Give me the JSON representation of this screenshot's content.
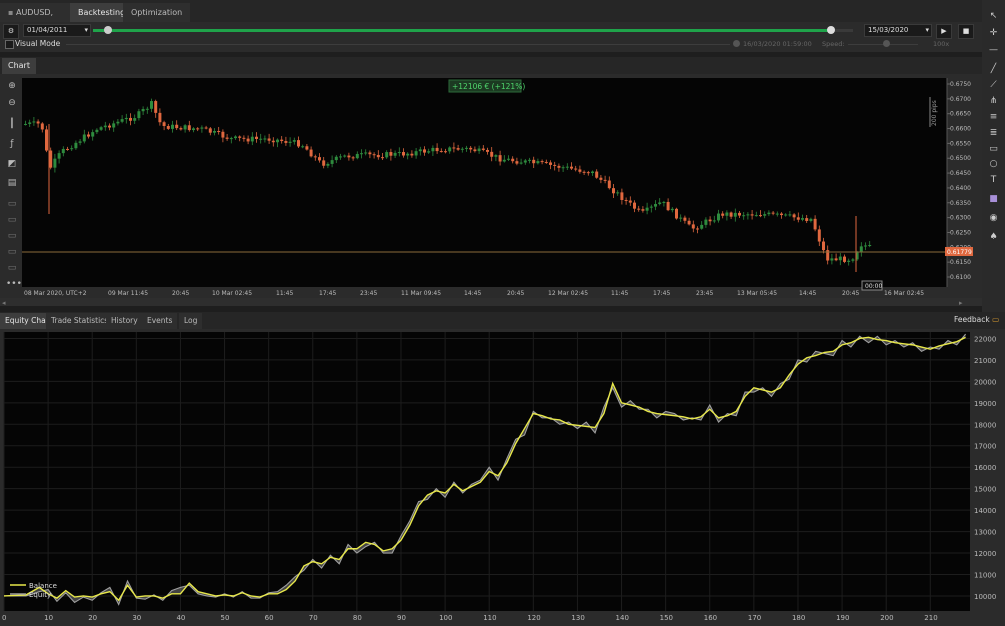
{
  "tabs": [
    {
      "label": "AUDUSD, m45",
      "icon": "chart-icon"
    },
    {
      "label": "Backtesting"
    },
    {
      "label": "Optimization"
    }
  ],
  "params": {
    "start_date": "01/04/2011",
    "end_date": "15/03/2020",
    "visual_mode_label": "Visual Mode",
    "current_time": "16/03/2020 01:59:00",
    "speed_label": "Speed:",
    "speed_value": "100x",
    "progress": 0.99
  },
  "chart": {
    "tab_label": "Chart",
    "profit_badge": "+12106 € (+121%)",
    "scale_label": "200 pips",
    "current_price": "0.61779",
    "price_ticks": [
      "0.6750",
      "0.6700",
      "0.6650",
      "0.6600",
      "0.6550",
      "0.6500",
      "0.6450",
      "0.6400",
      "0.6350",
      "0.6300",
      "0.6250",
      "0.6200",
      "0.6150",
      "0.6100"
    ],
    "time_ticks": [
      "08 Mar 2020, UTC+2",
      "09 Mar 11:45",
      "20:45",
      "10 Mar 02:45",
      "11:45",
      "17:45",
      "23:45",
      "11 Mar 09:45",
      "14:45",
      "20:45",
      "12 Mar 02:45",
      "11:45",
      "17:45",
      "23:45",
      "13 Mar 05:45",
      "14:45",
      "20:45",
      "16 Mar 02:45"
    ],
    "cursor_time": "00:00",
    "colors": {
      "bull": "#2e8b3e",
      "bear": "#e0683f",
      "price_line": "#8a6a3a"
    }
  },
  "bottom_tabs": [
    "Equity Chart",
    "Trade Statistics",
    "History",
    "Events",
    "Log"
  ],
  "feedback_label": "Feedback",
  "chart_data": {
    "type": "line",
    "xlabel": "",
    "ylabel": "",
    "x_ticks": [
      0,
      10,
      20,
      30,
      40,
      50,
      60,
      70,
      80,
      90,
      100,
      110,
      120,
      130,
      140,
      150,
      160,
      170,
      180,
      190,
      200,
      210
    ],
    "y_ticks": [
      10000,
      11000,
      12000,
      13000,
      14000,
      15000,
      16000,
      17000,
      18000,
      19000,
      20000,
      21000,
      22000
    ],
    "xlim": [
      0,
      219
    ],
    "ylim": [
      9300,
      22300
    ],
    "legend_position": "bottom-left",
    "series": [
      {
        "name": "Balance",
        "color": "#e8e84a",
        "x": [
          0,
          5,
          8,
          10,
          12,
          14,
          16,
          18,
          20,
          22,
          24,
          26,
          28,
          30,
          32,
          34,
          36,
          38,
          40,
          42,
          44,
          46,
          48,
          50,
          52,
          54,
          56,
          58,
          60,
          62,
          64,
          66,
          68,
          70,
          72,
          74,
          76,
          78,
          80,
          82,
          84,
          86,
          88,
          90,
          92,
          94,
          96,
          98,
          100,
          102,
          104,
          106,
          108,
          110,
          112,
          114,
          116,
          118,
          120,
          122,
          124,
          126,
          128,
          130,
          132,
          134,
          136,
          138,
          140,
          142,
          144,
          146,
          148,
          150,
          152,
          154,
          156,
          158,
          160,
          162,
          164,
          166,
          168,
          170,
          172,
          174,
          176,
          178,
          180,
          182,
          184,
          186,
          188,
          190,
          192,
          194,
          196,
          198,
          200,
          202,
          204,
          206,
          208,
          210,
          212,
          214,
          216,
          218
        ],
        "y": [
          10000,
          10050,
          10400,
          10100,
          9900,
          10250,
          9950,
          10000,
          9950,
          10100,
          10200,
          9800,
          10500,
          9950,
          10000,
          10000,
          9900,
          10100,
          10100,
          10600,
          10200,
          10100,
          10000,
          10050,
          10000,
          10150,
          10000,
          9950,
          10100,
          10100,
          10300,
          10700,
          11400,
          11600,
          11500,
          11800,
          11700,
          12200,
          12200,
          12500,
          12400,
          12100,
          12200,
          12600,
          13300,
          14200,
          14700,
          14900,
          14800,
          15200,
          14900,
          15100,
          15300,
          15800,
          15600,
          16200,
          17100,
          17800,
          18500,
          18400,
          18250,
          18200,
          18000,
          17950,
          17900,
          17850,
          18500,
          19900,
          19000,
          18900,
          18800,
          18600,
          18500,
          18450,
          18400,
          18350,
          18250,
          18350,
          18700,
          18300,
          18400,
          18600,
          19300,
          19700,
          19600,
          19500,
          19700,
          20300,
          20800,
          21100,
          21200,
          21350,
          21400,
          21700,
          21800,
          22000,
          22050,
          21950,
          21900,
          21800,
          21750,
          21700,
          21600,
          21500,
          21650,
          21750,
          21850,
          22050
        ]
      },
      {
        "name": "Equity",
        "color": "#a0a0a0",
        "x": [
          0,
          5,
          8,
          10,
          12,
          14,
          16,
          18,
          20,
          22,
          24,
          26,
          28,
          30,
          32,
          34,
          36,
          38,
          40,
          42,
          44,
          46,
          48,
          50,
          52,
          54,
          56,
          58,
          60,
          62,
          64,
          66,
          68,
          70,
          72,
          74,
          76,
          78,
          80,
          82,
          84,
          86,
          88,
          90,
          92,
          94,
          96,
          98,
          100,
          102,
          104,
          106,
          108,
          110,
          112,
          114,
          116,
          118,
          120,
          122,
          124,
          126,
          128,
          130,
          132,
          134,
          136,
          138,
          140,
          142,
          144,
          146,
          148,
          150,
          152,
          154,
          156,
          158,
          160,
          162,
          164,
          166,
          168,
          170,
          172,
          174,
          176,
          178,
          180,
          182,
          184,
          186,
          188,
          190,
          192,
          194,
          196,
          198,
          200,
          202,
          204,
          206,
          208,
          210,
          212,
          214,
          216,
          218
        ],
        "y": [
          10000,
          10000,
          10200,
          10300,
          9750,
          10150,
          9700,
          9950,
          9800,
          10150,
          10400,
          9600,
          10700,
          9900,
          9850,
          10050,
          9800,
          10250,
          10400,
          10500,
          10100,
          10000,
          9950,
          10100,
          9950,
          10200,
          9900,
          9900,
          10150,
          10200,
          10500,
          10900,
          11200,
          11700,
          11300,
          11900,
          11500,
          12400,
          12000,
          12300,
          12500,
          12000,
          12000,
          12800,
          13500,
          14400,
          14500,
          15000,
          14600,
          15300,
          14800,
          15200,
          15400,
          16000,
          15400,
          16400,
          17300,
          17500,
          18600,
          18300,
          18300,
          18000,
          18100,
          17800,
          18100,
          17600,
          18800,
          19700,
          18800,
          19100,
          18700,
          18700,
          18300,
          18600,
          18500,
          18200,
          18300,
          18200,
          18900,
          18100,
          18500,
          18400,
          19500,
          19500,
          19700,
          19300,
          19900,
          20100,
          21000,
          20900,
          21400,
          21300,
          21200,
          21900,
          21600,
          22100,
          21800,
          22100,
          21700,
          21900,
          21600,
          21800,
          21400,
          21600,
          21500,
          21900,
          21700,
          22200
        ]
      }
    ]
  }
}
